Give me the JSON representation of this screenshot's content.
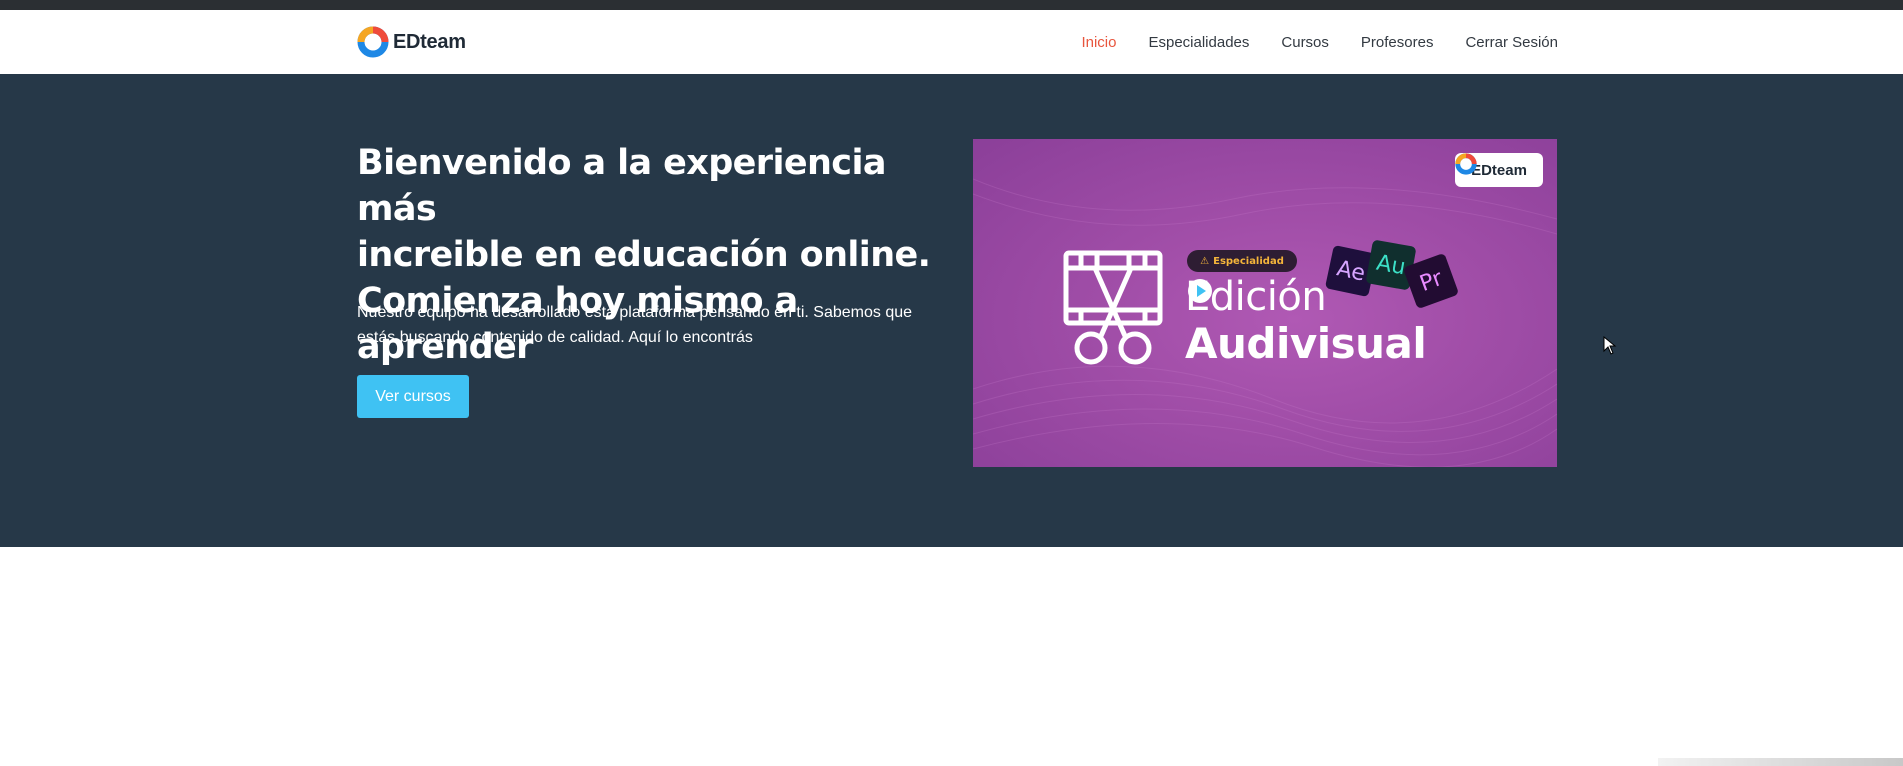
{
  "brand": {
    "name": "EDteam",
    "colors": {
      "ring_blue": "#1e88e5",
      "ring_red": "#ef4b3b",
      "ring_orange": "#f5a623",
      "text": "#1f2a36"
    }
  },
  "nav": {
    "items": [
      {
        "label": "Inicio",
        "active": true
      },
      {
        "label": "Especialidades",
        "active": false
      },
      {
        "label": "Cursos",
        "active": false
      },
      {
        "label": "Profesores",
        "active": false
      },
      {
        "label": "Cerrar Sesión",
        "active": false
      }
    ],
    "active_color": "#e8553d"
  },
  "hero": {
    "title_lines": [
      "Bienvenido a la experiencia más",
      "increible en educación online.",
      "Comienza hoy mismo a aprender"
    ],
    "description_lines": [
      "Nuestro equipo ha desarrollado esta plataforma pensando en ti. Sabemos que",
      "estás buscando contenido de calidad. Aquí lo encontrás"
    ],
    "cta_label": "Ver cursos",
    "background": "#263848",
    "cta_color": "#3fc2f3"
  },
  "banner": {
    "logo_text": "EDteam",
    "badge_text": "Especialidad",
    "title_line1": "Edición",
    "title_line2_a": "Audi",
    "title_line2_b": "visual",
    "apps": [
      "Ae",
      "Au",
      "Pr"
    ],
    "icon": "film-scissors-icon",
    "background": "#a14ea8"
  }
}
